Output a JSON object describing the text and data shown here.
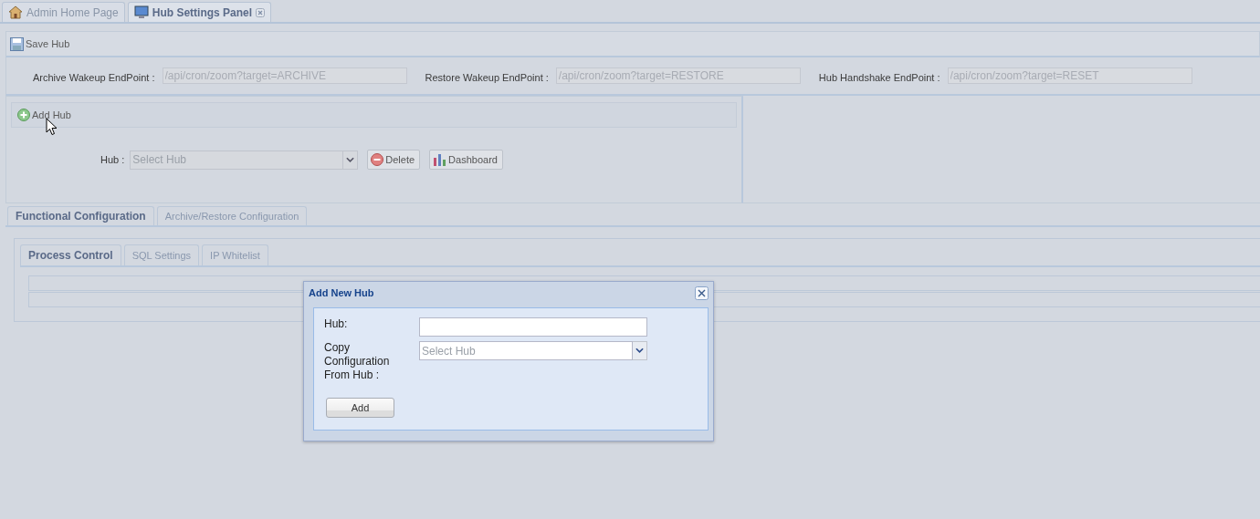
{
  "tabs": [
    {
      "label": "Admin Home Page",
      "selected": false,
      "kind": "home",
      "closable": false
    },
    {
      "label": "Hub Settings Panel",
      "selected": true,
      "kind": "monitor",
      "closable": true
    }
  ],
  "toolbar": {
    "save_button": "Save Hub"
  },
  "endpoints": [
    {
      "label": "Archive Wakeup EndPoint :",
      "value": "/api/cron/zoom?target=ARCHIVE"
    },
    {
      "label": "Restore Wakeup EndPoint :",
      "value": "/api/cron/zoom?target=RESTORE"
    },
    {
      "label": "Hub Handshake EndPoint :",
      "value": "/api/cron/zoom?target=RESET"
    }
  ],
  "hub_panel": {
    "add_button": "Add Hub",
    "hub_label": "Hub :",
    "hub_placeholder": "Select Hub",
    "delete_button": "Delete",
    "dashboard_button": "Dashboard"
  },
  "config_tabs": [
    {
      "label": "Functional Configuration",
      "selected": true
    },
    {
      "label": "Archive/Restore Configuration",
      "selected": false
    }
  ],
  "sub_tabs": [
    {
      "label": "Process Control",
      "selected": true
    },
    {
      "label": "SQL Settings",
      "selected": false
    },
    {
      "label": "IP Whitelist",
      "selected": false
    }
  ],
  "dialog": {
    "title": "Add New Hub",
    "fields": [
      {
        "label": "Hub:",
        "kind": "text"
      },
      {
        "label": "Copy Configuration From Hub :",
        "kind": "select",
        "placeholder": "Select Hub"
      }
    ],
    "button": "Add"
  }
}
